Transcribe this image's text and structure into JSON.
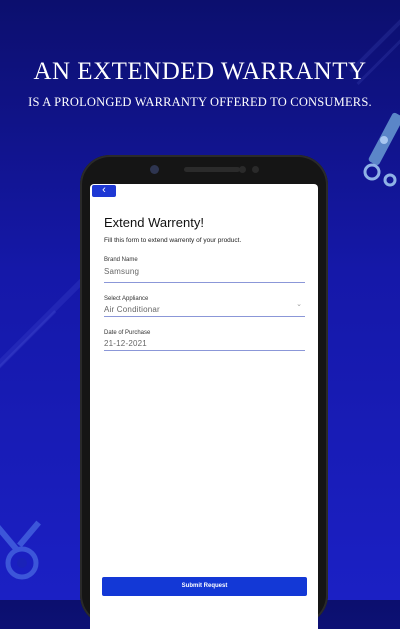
{
  "banner": {
    "headline": "AN EXTENDED WARRANTY",
    "subline": "IS A PROLONGED WARRANTY OFFERED TO CONSUMERS."
  },
  "form": {
    "back_label": "‹",
    "title": "Extend Warrenty!",
    "subtitle": "Fill this form to extend warrenty of your product.",
    "fields": [
      {
        "label": "Brand Name",
        "value": "Samsung"
      },
      {
        "label": "Select Appliance",
        "value": "Air Conditionar"
      },
      {
        "label": "Date of Purchase",
        "value": "21-12-2021"
      }
    ],
    "submit_label": "Submit Request"
  },
  "colors": {
    "background": "#1518a8",
    "primary_button": "#1338d6",
    "field_underline": "#8b97d8"
  },
  "icons": [
    "back-arrow-icon",
    "chevron-down-icon",
    "wrench-icon",
    "gear-icon"
  ]
}
